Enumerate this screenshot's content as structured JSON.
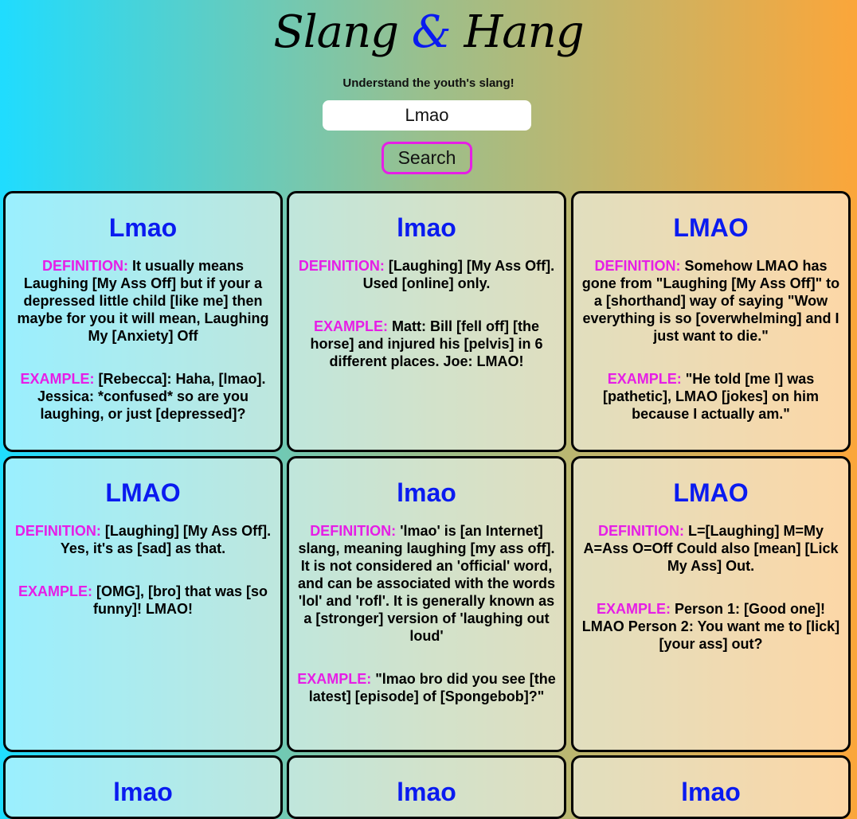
{
  "header": {
    "logo_part1": "Slang ",
    "logo_amp": "&",
    "logo_part2": " Hang",
    "tagline": "Understand the youth's slang!"
  },
  "search": {
    "value": "Lmao",
    "button_label": "Search"
  },
  "labels": {
    "definition": "DEFINITION:",
    "example": "EXAMPLE:"
  },
  "cards": [
    {
      "word": "Lmao",
      "definition": "It usually means Laughing [My Ass Off] but if your a depressed little child [like me] then maybe for you it will mean, Laughing My [Anxiety] Off",
      "example": "[Rebecca]: Haha, [lmao]. Jessica: *confused* so are you laughing, or just [depressed]?"
    },
    {
      "word": "lmao",
      "definition": "[Laughing] [My Ass Off]. Used [online] only.",
      "example": "Matt: Bill [fell off] [the horse] and injured his [pelvis] in 6 different places.  Joe: LMAO!"
    },
    {
      "word": "LMAO",
      "definition": "Somehow LMAO has gone from \"Laughing [My Ass Off]\" to a [shorthand] way of saying \"Wow everything is so [overwhelming] and I just want to die.\"",
      "example": "\"He told [me I] was [pathetic], LMAO [jokes] on him because I actually am.\""
    },
    {
      "word": "LMAO",
      "definition": "[Laughing] [My Ass Off]. Yes, it's as [sad] as that.",
      "example": "[OMG], [bro] that was [so funny]! LMAO!"
    },
    {
      "word": "lmao",
      "definition": "'lmao' is [an Internet] slang, meaning laughing [my ass off]. It is not considered an 'official' word, and can be associated with the words 'lol' and 'rofl'. It is generally known as a [stronger] version of 'laughing out loud'",
      "example": "\"lmao bro did you see [the latest] [episode] of [Spongebob]?\""
    },
    {
      "word": "LMAO",
      "definition": "L=[Laughing] M=My A=Ass O=Off Could also [mean] [Lick My Ass] Out.",
      "example": "Person 1: [Good one]! LMAO Person 2: You want me to [lick] [your ass] out?"
    },
    {
      "word": "lmao"
    },
    {
      "word": "lmao"
    },
    {
      "word": "lmao"
    }
  ]
}
